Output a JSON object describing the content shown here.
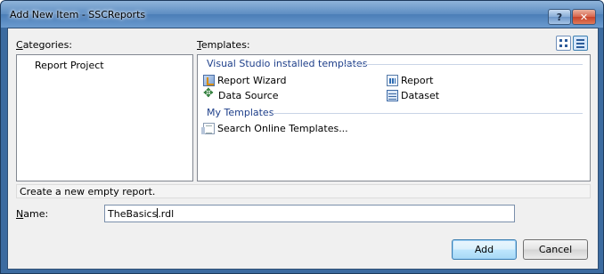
{
  "window": {
    "title": "Add New Item - SSCReports",
    "help_label": "?",
    "close_label": "✕"
  },
  "categories": {
    "label_first": "C",
    "label_rest": "ategories:",
    "items": [
      "Report Project"
    ]
  },
  "templates": {
    "label_first": "T",
    "label_rest": "emplates:",
    "groups": [
      {
        "heading": "Visual Studio installed templates",
        "items": [
          {
            "label": "Report Wizard",
            "icon": "report-wizard-icon"
          },
          {
            "label": "Report",
            "icon": "report-icon"
          },
          {
            "label": "Data Source",
            "icon": "data-source-icon"
          },
          {
            "label": "Dataset",
            "icon": "dataset-icon"
          }
        ]
      },
      {
        "heading": "My Templates",
        "items": [
          {
            "label": "Search Online Templates...",
            "icon": "search-online-icon"
          }
        ]
      }
    ]
  },
  "description": "Create a new empty report.",
  "name_field": {
    "label_first": "N",
    "label_rest": "ame:",
    "value_before_caret": "TheBasics",
    "value_after_caret": ".rdl"
  },
  "buttons": {
    "add": "Add",
    "cancel": "Cancel"
  },
  "colors": {
    "group_heading": "#1e3f8a",
    "title_bar": "#5d8dc2",
    "selected_view": "#d7e7fa"
  }
}
